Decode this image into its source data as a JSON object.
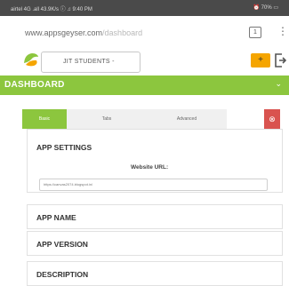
{
  "status_bar": {
    "left": "airtel 4G .all 43.9K/s ⓘ ♫ 9:40 PM",
    "right": "⏰ 70% ▭"
  },
  "browser": {
    "url_host": "www.appsgeyser.com",
    "url_path": "/dashboard",
    "tabs_count": "1",
    "menu_glyph": "⋮"
  },
  "app_header": {
    "project_name": "JIT STUDENTS -",
    "add_label": "+"
  },
  "dashboard": {
    "title": "DASHBOARD",
    "chevron": "⌄"
  },
  "tabs": [
    {
      "label": "Basic",
      "active": true
    },
    {
      "label": "Tabs",
      "active": false
    },
    {
      "label": "Advanced",
      "active": false
    }
  ],
  "close_glyph": "⊗",
  "settings": {
    "title": "APP SETTINGS",
    "website_label": "Website URL:",
    "website_value": "https://canvas2074.blogspot.in/"
  },
  "sections": [
    {
      "title": "APP NAME"
    },
    {
      "title": "APP VERSION"
    },
    {
      "title": "DESCRIPTION"
    }
  ],
  "colors": {
    "accent": "#8cc63e",
    "status_bar": "#4a4a4a",
    "add_button": "#f5a500",
    "close_button": "#d9534f"
  }
}
